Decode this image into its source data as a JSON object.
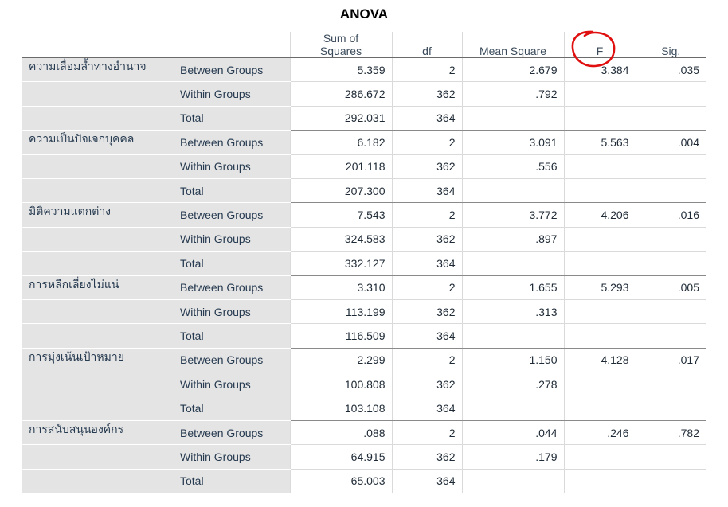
{
  "title": "ANOVA",
  "header": {
    "blank1": "",
    "blank2": "",
    "sum_of_squares": "Sum of\nSquares",
    "df": "df",
    "mean_square": "Mean Square",
    "f": "F",
    "sig": "Sig."
  },
  "annotation": {
    "type": "hand-drawn circle",
    "color": "#e01010",
    "target": "F"
  },
  "rows": [
    {
      "variable": "ความเลื่อมล้ำทางอำนาจ",
      "group": "Between Groups",
      "ss": "5.359",
      "df": "2",
      "ms": "2.679",
      "f": "3.384",
      "sig": ".035"
    },
    {
      "variable": "",
      "group": "Within Groups",
      "ss": "286.672",
      "df": "362",
      "ms": ".792",
      "f": "",
      "sig": ""
    },
    {
      "variable": "",
      "group": "Total",
      "ss": "292.031",
      "df": "364",
      "ms": "",
      "f": "",
      "sig": ""
    },
    {
      "variable": "ความเป็นปัจเจกบุคคล",
      "group": "Between Groups",
      "ss": "6.182",
      "df": "2",
      "ms": "3.091",
      "f": "5.563",
      "sig": ".004"
    },
    {
      "variable": "",
      "group": "Within Groups",
      "ss": "201.118",
      "df": "362",
      "ms": ".556",
      "f": "",
      "sig": ""
    },
    {
      "variable": "",
      "group": "Total",
      "ss": "207.300",
      "df": "364",
      "ms": "",
      "f": "",
      "sig": ""
    },
    {
      "variable": "มิติความแตกต่าง",
      "group": "Between Groups",
      "ss": "7.543",
      "df": "2",
      "ms": "3.772",
      "f": "4.206",
      "sig": ".016"
    },
    {
      "variable": "",
      "group": "Within Groups",
      "ss": "324.583",
      "df": "362",
      "ms": ".897",
      "f": "",
      "sig": ""
    },
    {
      "variable": "",
      "group": "Total",
      "ss": "332.127",
      "df": "364",
      "ms": "",
      "f": "",
      "sig": ""
    },
    {
      "variable": "การหลีกเลี่ยงไม่แน่",
      "group": "Between Groups",
      "ss": "3.310",
      "df": "2",
      "ms": "1.655",
      "f": "5.293",
      "sig": ".005"
    },
    {
      "variable": "",
      "group": "Within Groups",
      "ss": "113.199",
      "df": "362",
      "ms": ".313",
      "f": "",
      "sig": ""
    },
    {
      "variable": "",
      "group": "Total",
      "ss": "116.509",
      "df": "364",
      "ms": "",
      "f": "",
      "sig": ""
    },
    {
      "variable": "การมุ่งเน้นเป้าหมาย",
      "group": "Between Groups",
      "ss": "2.299",
      "df": "2",
      "ms": "1.150",
      "f": "4.128",
      "sig": ".017"
    },
    {
      "variable": "",
      "group": "Within Groups",
      "ss": "100.808",
      "df": "362",
      "ms": ".278",
      "f": "",
      "sig": ""
    },
    {
      "variable": "",
      "group": "Total",
      "ss": "103.108",
      "df": "364",
      "ms": "",
      "f": "",
      "sig": ""
    },
    {
      "variable": "การสนับสนุนองค์กร",
      "group": "Between Groups",
      "ss": ".088",
      "df": "2",
      "ms": ".044",
      "f": ".246",
      "sig": ".782"
    },
    {
      "variable": "",
      "group": "Within Groups",
      "ss": "64.915",
      "df": "362",
      "ms": ".179",
      "f": "",
      "sig": ""
    },
    {
      "variable": "",
      "group": "Total",
      "ss": "65.003",
      "df": "364",
      "ms": "",
      "f": "",
      "sig": ""
    }
  ]
}
